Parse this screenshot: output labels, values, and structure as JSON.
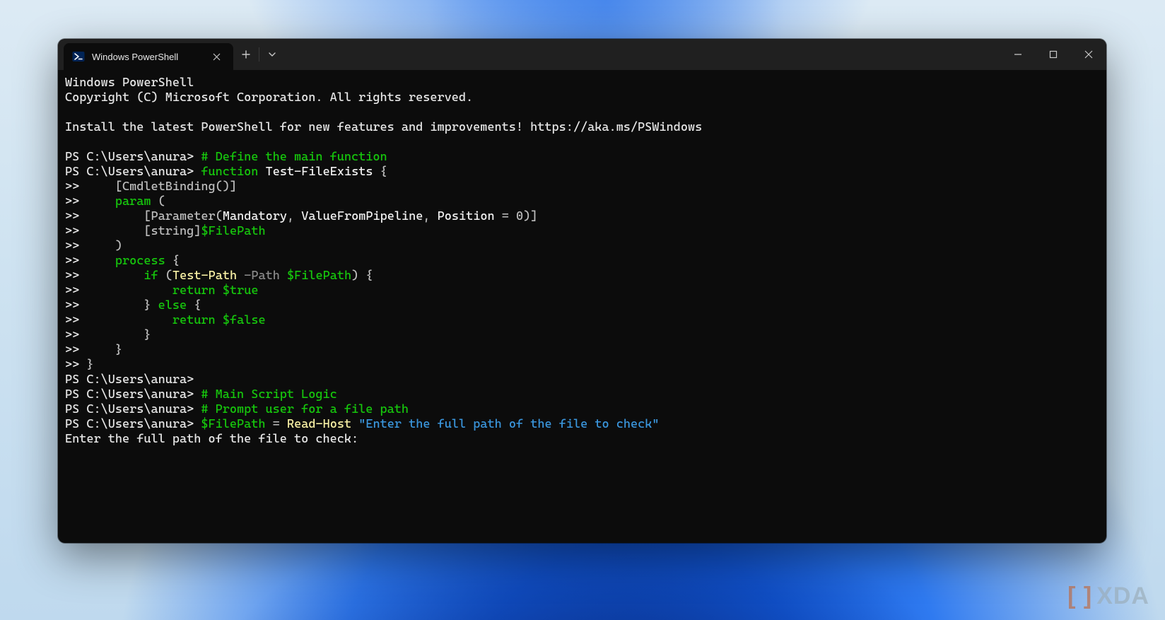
{
  "window": {
    "tab_title": "Windows PowerShell"
  },
  "header": {
    "line1": "Windows PowerShell",
    "line2": "Copyright (C) Microsoft Corporation. All rights reserved.",
    "line3": "Install the latest PowerShell for new features and improvements! https://aka.ms/PSWindows"
  },
  "prompt": "PS C:\\Users\\anura>",
  "cont": ">>",
  "code": {
    "c1_comment": "# Define the main function",
    "c2_kw_function": "function",
    "c2_name": "Test-FileExists",
    "c2_brace": "{",
    "c3": "    [CmdletBinding()]",
    "c4_kw": "param",
    "c4_paren": " (",
    "c5_pre": "        [",
    "c5_p": "Parameter",
    "c5_open": "(",
    "c5_a1": "Mandatory",
    "c5_sep1": ", ",
    "c5_a2": "ValueFromPipeline",
    "c5_sep2": ", ",
    "c5_a3": "Position",
    "c5_eq": " = ",
    "c5_val": "0",
    "c5_close": ")]",
    "c6_pre": "        [",
    "c6_type": "string",
    "c6_close": "]",
    "c6_var": "$FilePath",
    "c7": "    )",
    "c8_kw": "process",
    "c8_brace": " {",
    "c9_pre": "        ",
    "c9_kw_if": "if",
    "c9_open": " (",
    "c9_cmd": "Test-Path",
    "c9_param": " -Path",
    "c9_sp": " ",
    "c9_var": "$FilePath",
    "c9_close": ") {",
    "c10_pre": "            ",
    "c10_kw": "return",
    "c10_sp": " ",
    "c10_val": "$true",
    "c11": "        } ",
    "c11_kw": "else",
    "c11_brace": " {",
    "c12_pre": "            ",
    "c12_kw": "return",
    "c12_sp": " ",
    "c12_val": "$false",
    "c13": "        }",
    "c14": "    }",
    "c15": "}",
    "c16_comment": "# Main Script Logic",
    "c17_comment": "# Prompt user for a file path",
    "c18_var": "$FilePath",
    "c18_eq": " = ",
    "c18_cmd": "Read-Host",
    "c18_sp": " ",
    "c18_str": "\"Enter the full path of the file to check\"",
    "c19": "Enter the full path of the file to check:"
  },
  "watermark": {
    "brand": "XDA"
  }
}
